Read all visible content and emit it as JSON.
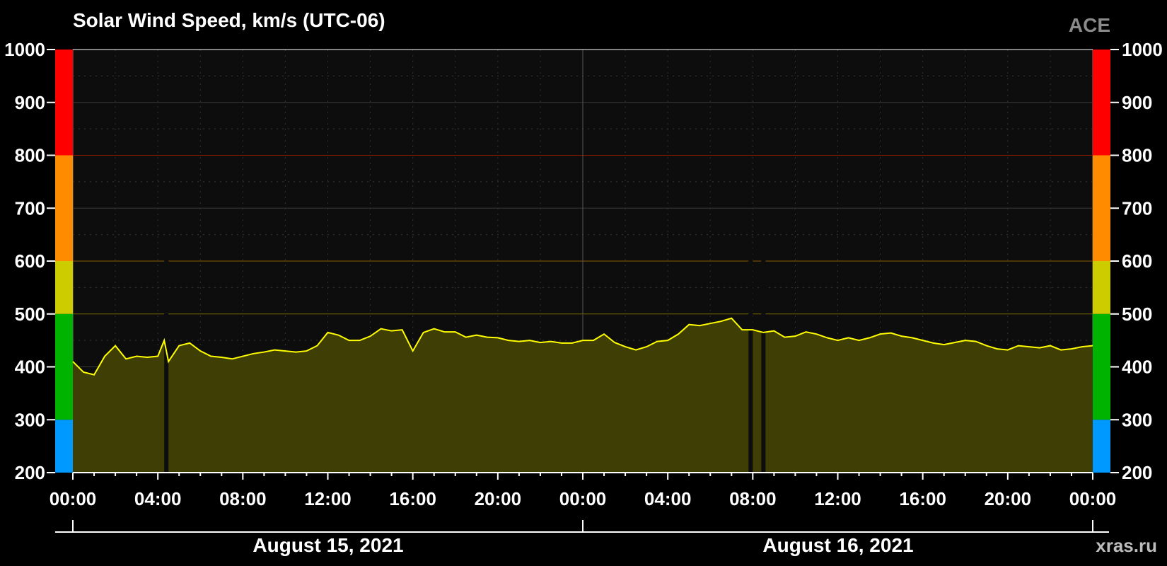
{
  "chart_data": {
    "type": "area",
    "title": "Solar Wind Speed, km/s (UTC-06)",
    "source": "ACE",
    "site": "xras.ru",
    "ylim": [
      200,
      1000
    ],
    "yticks": [
      "200",
      "300",
      "400",
      "500",
      "600",
      "700",
      "800",
      "900",
      "1000"
    ],
    "xlim_hours": [
      0,
      48
    ],
    "xticks": [
      "00:00",
      "04:00",
      "08:00",
      "12:00",
      "16:00",
      "20:00",
      "00:00",
      "04:00",
      "08:00",
      "12:00",
      "16:00",
      "20:00",
      "00:00"
    ],
    "dates": [
      "August 15, 2021",
      "August 16, 2021"
    ],
    "thresholds": [
      {
        "from": 200,
        "to": 300,
        "color": "#0099ff"
      },
      {
        "from": 300,
        "to": 500,
        "color": "#00b300"
      },
      {
        "from": 500,
        "to": 600,
        "color": "#cccc00"
      },
      {
        "from": 600,
        "to": 800,
        "color": "#ff8c00"
      },
      {
        "from": 800,
        "to": 1000,
        "color": "#ff0000"
      }
    ],
    "line_color": "#ffff00",
    "fill_color": "#3f3f05",
    "series": [
      {
        "x": [
          0,
          0.5,
          1,
          1.5,
          2,
          2.5,
          3,
          3.5,
          4,
          4.3,
          4.5,
          5,
          5.5,
          6,
          6.5,
          7,
          7.5,
          8,
          8.5,
          9,
          9.5,
          10,
          10.5,
          11,
          11.5,
          12,
          12.5,
          13,
          13.5,
          14,
          14.5,
          15,
          15.5,
          16,
          16.5,
          17,
          17.5,
          18,
          18.5,
          19,
          19.5,
          20,
          20.5,
          21,
          21.5,
          22,
          22.5,
          23,
          23.5,
          24,
          24.5,
          25,
          25.5,
          26,
          26.5,
          27,
          27.5,
          28,
          28.5,
          29,
          29.5,
          30,
          30.5,
          31,
          31.5,
          32,
          32.5,
          33,
          33.5,
          34,
          34.5,
          35,
          35.5,
          36,
          36.5,
          37,
          37.5,
          38,
          38.5,
          39,
          39.5,
          40,
          40.5,
          41,
          41.5,
          42,
          42.5,
          43,
          43.5,
          44,
          44.5,
          45,
          45.5,
          46,
          46.5,
          47,
          47.5,
          48
        ],
        "y": [
          410,
          390,
          385,
          420,
          440,
          415,
          420,
          418,
          420,
          450,
          410,
          440,
          445,
          430,
          420,
          418,
          415,
          420,
          425,
          428,
          432,
          430,
          428,
          430,
          440,
          465,
          460,
          450,
          450,
          458,
          472,
          468,
          470,
          430,
          465,
          472,
          466,
          466,
          456,
          460,
          456,
          455,
          450,
          448,
          450,
          446,
          448,
          445,
          445,
          450,
          450,
          462,
          446,
          438,
          432,
          438,
          448,
          450,
          462,
          480,
          478,
          482,
          486,
          492,
          470,
          470,
          465,
          468,
          456,
          458,
          466,
          462,
          455,
          450,
          455,
          450,
          455,
          462,
          464,
          458,
          455,
          450,
          445,
          442,
          446,
          450,
          448,
          440,
          434,
          432,
          440,
          438,
          436,
          440,
          432,
          434,
          438,
          440
        ]
      }
    ],
    "gaps_hours": [
      [
        4.3,
        4.5
      ],
      [
        31.8,
        32.0
      ],
      [
        32.4,
        32.6
      ]
    ]
  }
}
